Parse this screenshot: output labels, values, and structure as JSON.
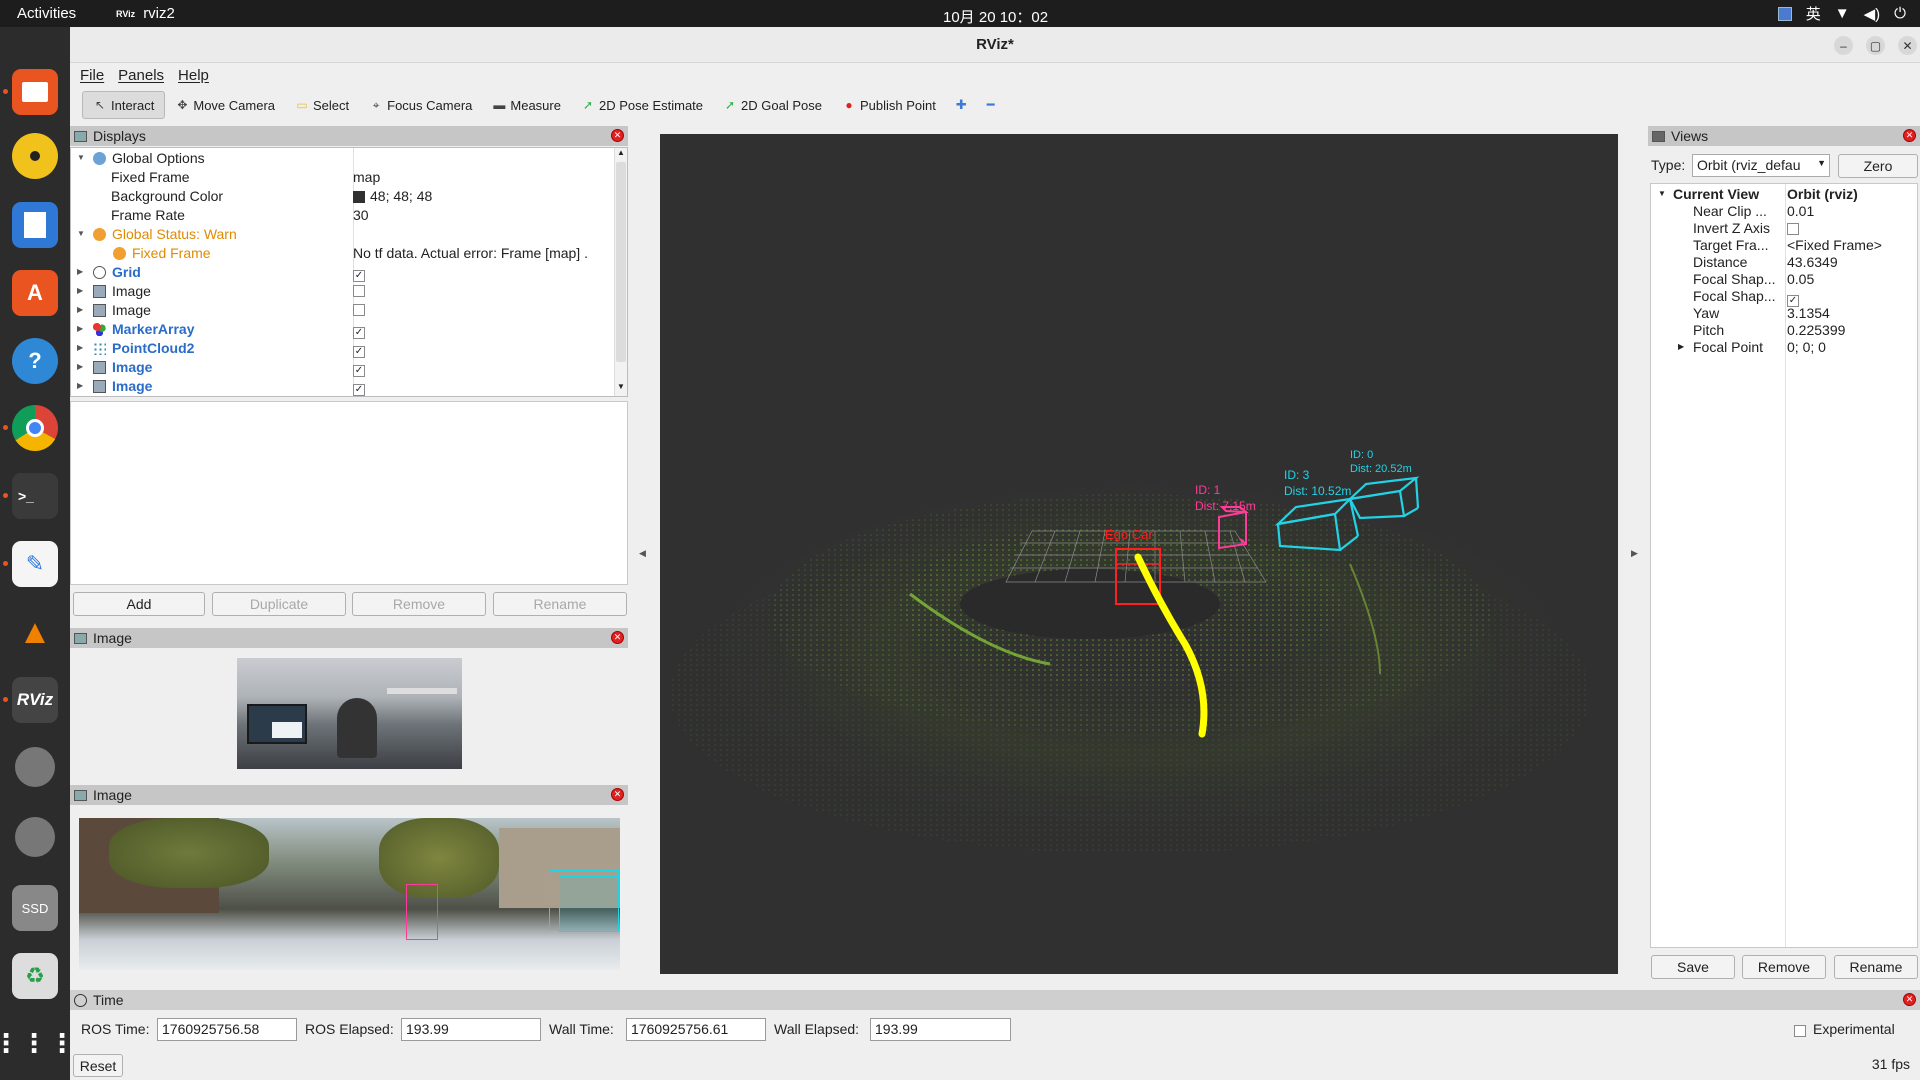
{
  "topbar": {
    "activities": "Activities",
    "app_name": "rviz2",
    "app_icon_text": "RViz",
    "clock": "10月 20  10：02",
    "lang": "英"
  },
  "window": {
    "title": "RViz*"
  },
  "menu": {
    "file": "File",
    "panels": "Panels",
    "help": "Help"
  },
  "toolbar": [
    {
      "label": "Interact",
      "icon": "cursor-icon",
      "active": true
    },
    {
      "label": "Move Camera",
      "icon": "move-camera-icon"
    },
    {
      "label": "Select",
      "icon": "select-icon"
    },
    {
      "label": "Focus Camera",
      "icon": "focus-camera-icon"
    },
    {
      "label": "Measure",
      "icon": "ruler-icon"
    },
    {
      "label": "2D Pose Estimate",
      "icon": "pose-arrow-icon"
    },
    {
      "label": "2D Goal Pose",
      "icon": "goal-arrow-icon"
    },
    {
      "label": "Publish Point",
      "icon": "map-pin-icon"
    }
  ],
  "displays": {
    "title": "Displays",
    "global_options": "Global Options",
    "fixed_frame_label": "Fixed Frame",
    "fixed_frame_value": "map",
    "bg_color_label": "Background Color",
    "bg_color_value": "48; 48; 48",
    "frame_rate_label": "Frame Rate",
    "frame_rate_value": "30",
    "global_status": "Global Status: Warn",
    "status_fixed_frame": "Fixed Frame",
    "status_fixed_frame_msg": "No tf data.  Actual error: Frame [map] .",
    "items": [
      {
        "name": "Grid",
        "checked": true,
        "bold": true
      },
      {
        "name": "Image",
        "checked": false,
        "bold": false
      },
      {
        "name": "Image",
        "checked": false,
        "bold": false
      },
      {
        "name": "MarkerArray",
        "checked": true,
        "bold": true
      },
      {
        "name": "PointCloud2",
        "checked": true,
        "bold": true
      },
      {
        "name": "Image",
        "checked": true,
        "bold": true
      },
      {
        "name": "Image",
        "checked": true,
        "bold": true
      }
    ],
    "buttons": {
      "add": "Add",
      "duplicate": "Duplicate",
      "remove": "Remove",
      "rename": "Rename"
    }
  },
  "image_panel_1": {
    "title": "Image"
  },
  "image_panel_2": {
    "title": "Image"
  },
  "scene": {
    "ego_label": "Ego Car",
    "markers": [
      {
        "id": "ID:   1",
        "dist": "Dist:  7.15m",
        "color": "#ff3b9a"
      },
      {
        "id": "ID:   3",
        "dist": "Dist:   10.52m",
        "color": "#22d3e6"
      },
      {
        "id": "ID:   0",
        "dist": "Dist:   20.52m",
        "color": "#22d3e6"
      }
    ]
  },
  "views": {
    "title": "Views",
    "type_label": "Type:",
    "type_value": "Orbit (rviz_defau",
    "zero": "Zero",
    "current_view": "Current View",
    "current_view_value": "Orbit (rviz)",
    "props": [
      {
        "k": "Near Clip ...",
        "v": "0.01"
      },
      {
        "k": "Invert Z Axis",
        "v": "",
        "check": false
      },
      {
        "k": "Target Fra...",
        "v": "<Fixed Frame>"
      },
      {
        "k": "Distance",
        "v": "43.6349"
      },
      {
        "k": "Focal Shap...",
        "v": "0.05"
      },
      {
        "k": "Focal Shap...",
        "v": "",
        "check": true
      },
      {
        "k": "Yaw",
        "v": "3.1354"
      },
      {
        "k": "Pitch",
        "v": "0.225399"
      },
      {
        "k": "Focal Point",
        "v": "0; 0; 0"
      }
    ],
    "buttons": {
      "save": "Save",
      "remove": "Remove",
      "rename": "Rename"
    }
  },
  "time": {
    "title": "Time",
    "ros_time_label": "ROS Time:",
    "ros_time": "1760925756.58",
    "ros_elapsed_label": "ROS Elapsed:",
    "ros_elapsed": "193.99",
    "wall_time_label": "Wall Time:",
    "wall_time": "1760925756.61",
    "wall_elapsed_label": "Wall Elapsed:",
    "wall_elapsed": "193.99",
    "experimental": "Experimental",
    "reset": "Reset",
    "fps": "31 fps"
  },
  "dock_ssd": "SSD"
}
